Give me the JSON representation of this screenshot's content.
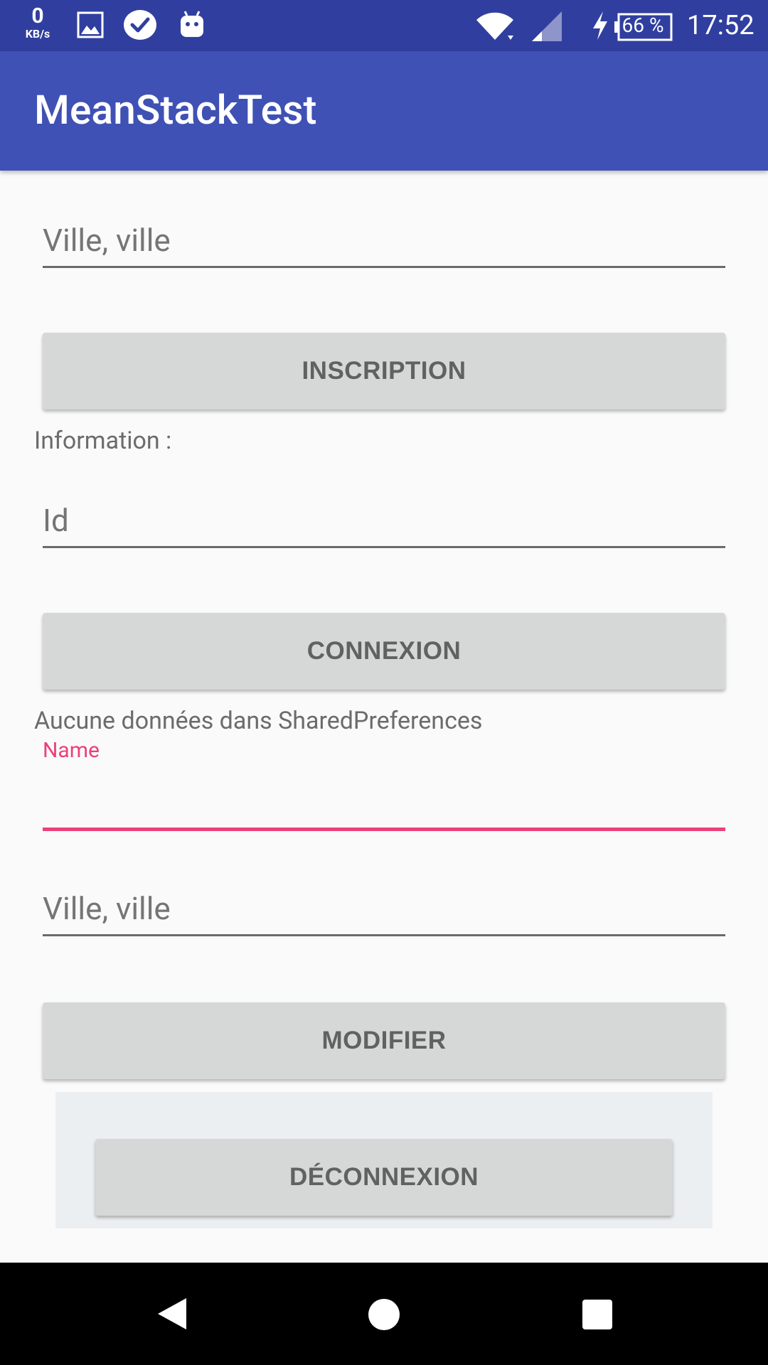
{
  "status_bar": {
    "net_speed_value": "0",
    "net_speed_unit": "KB/s",
    "notification_icons": [
      "gallery-icon",
      "check-cloud-icon",
      "android-icon"
    ],
    "battery_percent": "66 %",
    "time": "17:52",
    "background": "#303f9f"
  },
  "app_bar": {
    "title": "MeanStackTest",
    "background": "#3f51b5"
  },
  "form": {
    "city_field_1": {
      "placeholder": "Ville, ville"
    },
    "inscription_button": "INSCRIPTION",
    "information_label": "Information :",
    "id_field": {
      "placeholder": "Id"
    },
    "connexion_button": "CONNEXION",
    "shared_prefs_message": "Aucune données dans SharedPreferences",
    "name_field": {
      "label": "Name",
      "value": ""
    },
    "city_field_2": {
      "placeholder": "Ville, ville"
    },
    "modifier_button": "MODIFIER",
    "deconnexion_button": "DÉCONNEXION"
  },
  "colors": {
    "accent": "#ec407a",
    "button_bg": "#d6d7d7",
    "button_text": "#616161"
  },
  "nav_bar": {
    "icons": [
      "back-icon",
      "home-icon",
      "recents-icon"
    ]
  }
}
